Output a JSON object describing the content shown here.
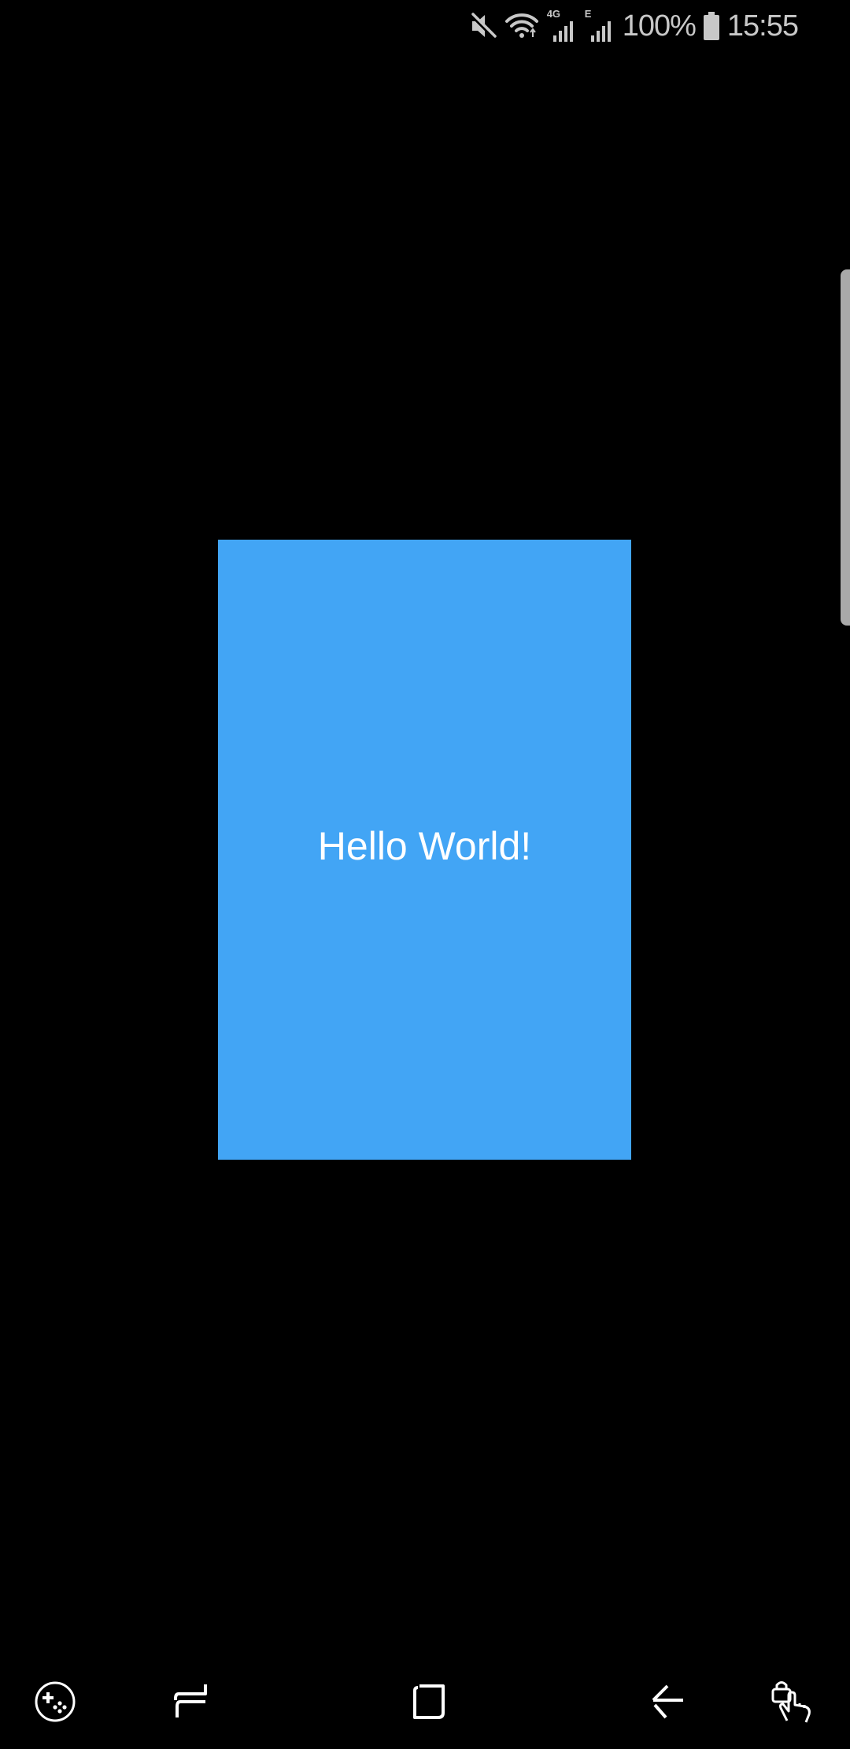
{
  "status_bar": {
    "battery_percent": "100%",
    "time": "15:55",
    "network_1": "4G",
    "network_2": "E",
    "icons": [
      "mute-icon",
      "wifi-icon",
      "signal-4g-icon",
      "signal-e-icon",
      "battery-icon"
    ]
  },
  "main": {
    "card_text": "Hello World!",
    "card_color": "#42a5f5"
  },
  "nav_bar": {
    "icons": [
      "game-tools-icon",
      "recent-apps-icon",
      "home-icon",
      "back-icon",
      "touch-lock-icon"
    ]
  },
  "colors": {
    "background": "#000000",
    "status_text": "#c8c8c8",
    "edge_handle": "#a9a9a9"
  }
}
